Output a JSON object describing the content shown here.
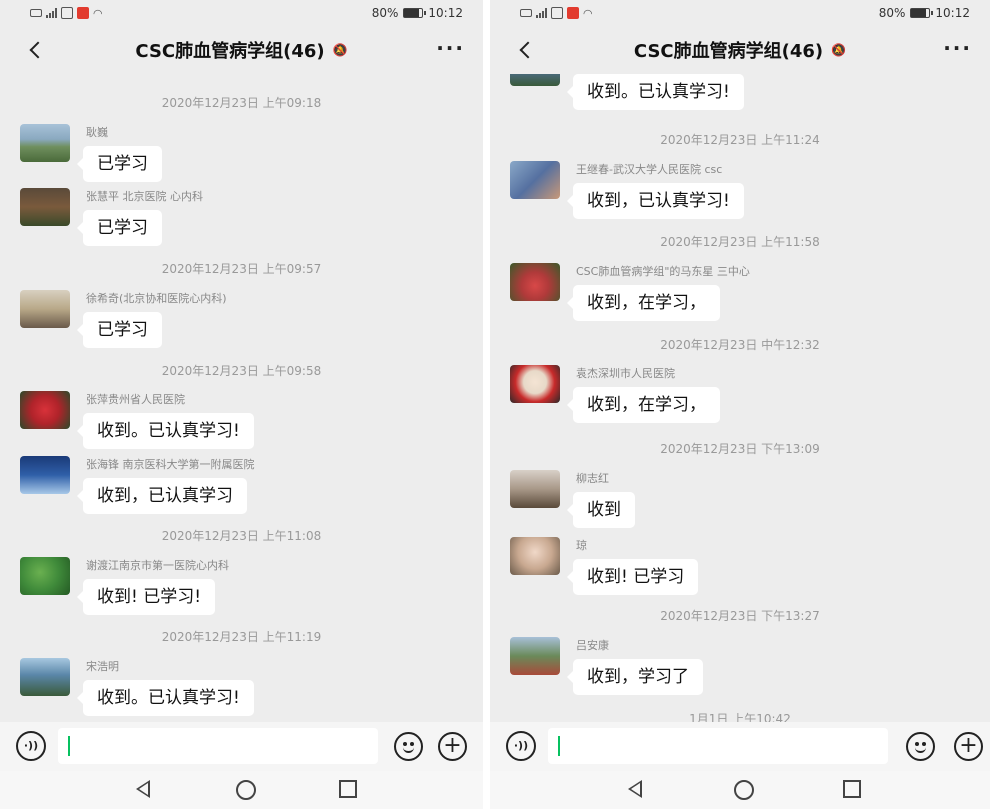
{
  "left": {
    "status": {
      "battery": "80%",
      "time": "10:12",
      "battery_level": 0.8
    },
    "header": {
      "title": "CSC肺血管病学组(46)"
    },
    "timestamps": [
      "2020年12月23日 上午09:18",
      "2020年12月23日 上午09:57",
      "2020年12月23日 上午09:58",
      "2020年12月23日 上午11:08",
      "2020年12月23日 上午11:19"
    ],
    "messages": [
      {
        "sender": "耿巍",
        "text": "已学习",
        "avatar_color": "#6f8f5e"
      },
      {
        "sender": "张慧平 北京医院 心内科",
        "text": "已学习",
        "avatar_color": "#7a5a3c"
      },
      {
        "sender": "徐希奇(北京协和医院心内科)",
        "text": "已学习",
        "avatar_color": "#b8a888"
      },
      {
        "sender": "张萍贵州省人民医院",
        "text": "收到。已认真学习!",
        "avatar_color": "#b0232a"
      },
      {
        "sender": "张海锋 南京医科大学第一附属医院",
        "text": "收到，已认真学习",
        "avatar_color": "#2f5fa8"
      },
      {
        "sender": "谢渡江南京市第一医院心内科",
        "text": "收到! 已学习!",
        "avatar_color": "#3f8a3a"
      },
      {
        "sender": "宋浩明",
        "text": "收到。已认真学习!",
        "avatar_color": "#5a86a8"
      }
    ]
  },
  "right": {
    "status": {
      "battery": "80%",
      "time": "10:12",
      "battery_level": 0.8
    },
    "header": {
      "title": "CSC肺血管病学组(46)"
    },
    "timestamps": [
      "2020年12月23日 上午11:24",
      "2020年12月23日 上午11:58",
      "2020年12月23日 中午12:32",
      "2020年12月23日 下午13:09",
      "2020年12月23日 下午13:27",
      "1月1日 上午10:42"
    ],
    "messages": [
      {
        "sender": "",
        "text": "收到。已认真学习!",
        "avatar_color": "#4e6e88"
      },
      {
        "sender": "王继春-武汉大学人民医院 csc",
        "text": "收到，已认真学习!",
        "avatar_color": "#5570a0"
      },
      {
        "sender": "CSC肺血管病学组\"的马东星 三中心",
        "text": "收到，在学习，",
        "avatar_color": "#b03a3a"
      },
      {
        "sender": "袁杰深圳市人民医院",
        "text": "收到，在学习，",
        "avatar_color": "#e7d9c8"
      },
      {
        "sender": "柳志红",
        "text": "收到",
        "avatar_color": "#a89888"
      },
      {
        "sender": "琼",
        "text": "收到! 已学习",
        "avatar_color": "#c8a890"
      },
      {
        "sender": "吕安康",
        "text": "收到，学习了",
        "avatar_color": "#6a8a5a"
      }
    ]
  },
  "icons": [
    "back-icon",
    "mute-icon",
    "more-icon",
    "voice-icon",
    "emoji-icon",
    "plus-icon",
    "nav-back-icon",
    "nav-home-icon",
    "nav-recent-icon"
  ],
  "colors": {
    "chat_bg": "#ededed",
    "bubble": "#ffffff",
    "cursor": "#07c160"
  }
}
